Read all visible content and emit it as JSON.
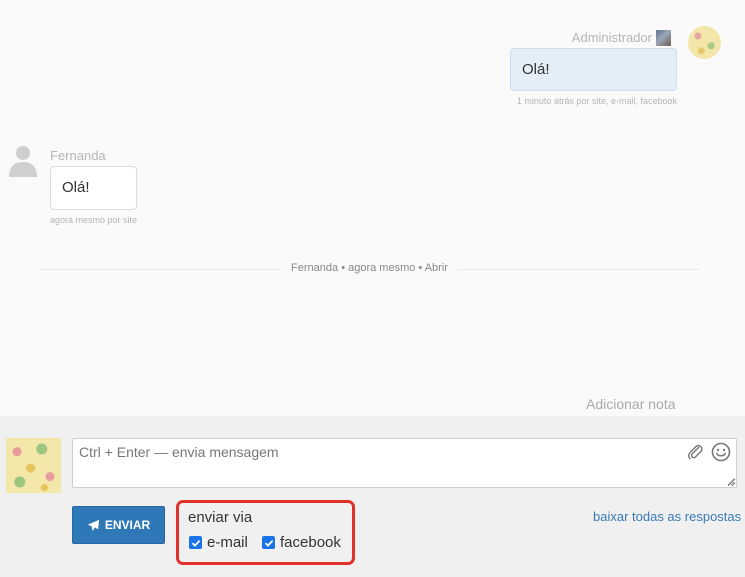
{
  "conversation": {
    "outgoing": {
      "author": "Administrador",
      "text": "Olá!",
      "meta": "1 minuto atrás por site, e-mail, facebook"
    },
    "incoming": {
      "author": "Fernanda",
      "text": "Olá!",
      "meta": "agora mesmo por site"
    },
    "status_line": "Fernanda • agora mesmo • Abrir",
    "add_note_label": "Adicionar nota"
  },
  "composer": {
    "placeholder": "Ctrl + Enter — envia mensagem",
    "send_label": "ENVIAR",
    "send_via_title": "enviar via",
    "channels": [
      {
        "label": "e-mail",
        "checked": true
      },
      {
        "label": "facebook",
        "checked": true
      }
    ],
    "download_link": "baixar todas as respostas"
  },
  "icons": {
    "attach": "paperclip-icon",
    "emoji": "smiley-icon",
    "send": "paper-plane-icon",
    "customer": "user-silhouette-icon"
  },
  "colors": {
    "accent": "#2f78b8",
    "highlight_border": "#e0322a",
    "outgoing_bubble": "#e3eef8"
  }
}
